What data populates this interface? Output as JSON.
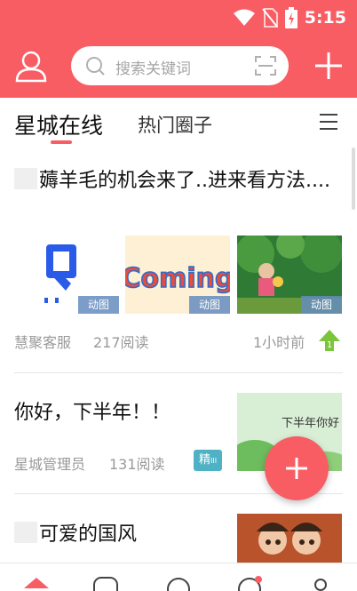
{
  "status_bar": {
    "time": "5:15",
    "icons": [
      "wifi-icon",
      "no-sim-icon",
      "battery-charging-icon"
    ]
  },
  "header": {
    "search_placeholder": "搜索关键词",
    "icons": {
      "profile": "user-icon",
      "search": "search-icon",
      "scan": "scan-icon",
      "add": "plus-icon"
    },
    "accent_color": "#f85d64"
  },
  "tabs": {
    "active": "星城在线",
    "other": "热门圈子",
    "menu_icon": "menu-icon"
  },
  "posts": [
    {
      "title": "薅羊毛的机会来了..进来看方法....",
      "images": [
        {
          "badge": "动图",
          "icon": "pointing-hand-icon"
        },
        {
          "badge": "动图",
          "text": "Coming"
        },
        {
          "badge": "动图",
          "icon": "forest-girl-illustration"
        }
      ],
      "author": "慧聚客服",
      "reads": "217阅读",
      "time": "1小时前",
      "rank_badge": "1"
    },
    {
      "title": "你好，下半年！！",
      "image_text": "下半年你好",
      "author": "星城管理员",
      "reads": "131阅读",
      "badge": "精",
      "badge_suffix": "III"
    },
    {
      "title": "可爱的国风",
      "image_icon": "chinese-style-dolls-illustration"
    }
  ],
  "fab": {
    "icon": "plus-icon"
  },
  "bottom_nav": {
    "items": [
      "home-icon",
      "chat-icon",
      "discover-icon",
      "message-icon",
      "profile-icon"
    ]
  }
}
